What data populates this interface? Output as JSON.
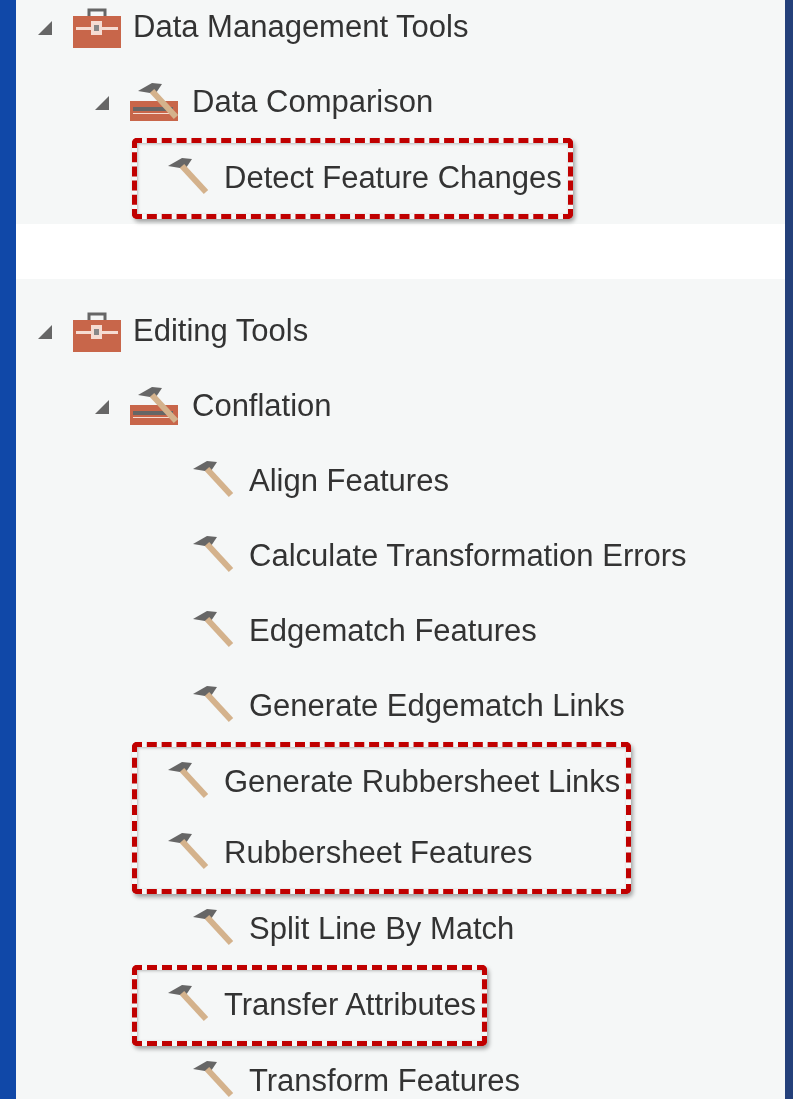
{
  "panels": [
    {
      "nodes": [
        {
          "label": "Data Management Tools",
          "kind": "toolbox",
          "expanded": true,
          "children": [
            {
              "label": "Data Comparison",
              "kind": "toolset",
              "expanded": true,
              "children": [
                {
                  "label": "Detect Feature Changes",
                  "kind": "tool",
                  "highlighted": true
                }
              ]
            }
          ]
        }
      ]
    },
    {
      "nodes": [
        {
          "label": "Editing Tools",
          "kind": "toolbox",
          "expanded": true,
          "children": [
            {
              "label": "Conflation",
              "kind": "toolset",
              "expanded": true,
              "children": [
                {
                  "label": "Align Features",
                  "kind": "tool",
                  "highlighted": false
                },
                {
                  "label": "Calculate Transformation Errors",
                  "kind": "tool",
                  "highlighted": false
                },
                {
                  "label": "Edgematch Features",
                  "kind": "tool",
                  "highlighted": false
                },
                {
                  "label": "Generate Edgematch Links",
                  "kind": "tool",
                  "highlighted": false
                },
                {
                  "label": "Generate Rubbersheet Links",
                  "kind": "tool",
                  "highlighted": true
                },
                {
                  "label": "Rubbersheet Features",
                  "kind": "tool",
                  "highlighted": true
                },
                {
                  "label": "Split Line By Match",
                  "kind": "tool",
                  "highlighted": false
                },
                {
                  "label": "Transfer Attributes",
                  "kind": "tool",
                  "highlighted": true
                },
                {
                  "label": "Transform Features",
                  "kind": "tool",
                  "highlighted": false
                }
              ]
            }
          ]
        }
      ]
    }
  ]
}
